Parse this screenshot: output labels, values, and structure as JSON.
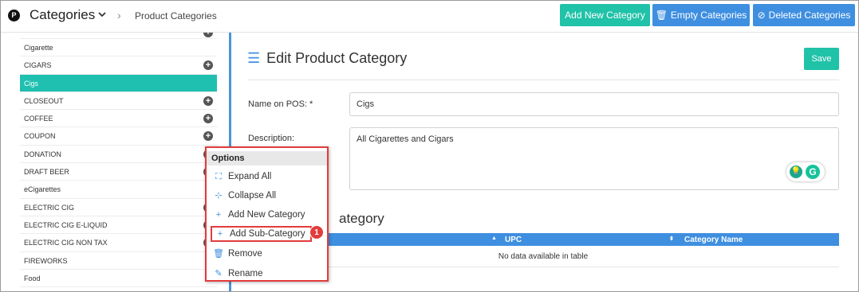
{
  "header": {
    "logo_letter": "P",
    "title": "Categories",
    "breadcrumb_sep": "›",
    "breadcrumb": "Product Categories",
    "add_new_label": "Add New Category",
    "empty_label": "Empty Categories",
    "deleted_label": "Deleted Categories"
  },
  "sidebar": {
    "items": [
      {
        "label": "",
        "plus": true,
        "partial": true
      },
      {
        "label": "Cigarette",
        "plus": false
      },
      {
        "label": "CIGARS",
        "plus": true
      },
      {
        "label": "Cigs",
        "plus": false,
        "selected": true
      },
      {
        "label": "CLOSEOUT",
        "plus": true
      },
      {
        "label": "COFFEE",
        "plus": true
      },
      {
        "label": "COUPON",
        "plus": true
      },
      {
        "label": "DONATION",
        "plus": true
      },
      {
        "label": "DRAFT BEER",
        "plus": true
      },
      {
        "label": "eCigarettes",
        "plus": false
      },
      {
        "label": "ELECTRIC CIG",
        "plus": true
      },
      {
        "label": "ELECTRIC CIG E-LIQUID",
        "plus": true
      },
      {
        "label": "ELECTRIC CIG NON TAX",
        "plus": true
      },
      {
        "label": "FIREWORKS",
        "plus": false
      },
      {
        "label": "Food",
        "plus": false
      }
    ]
  },
  "form": {
    "title": "Edit Product Category",
    "save_label": "Save",
    "name_label": "Name on POS: *",
    "name_value": "Cigs",
    "desc_label": "Description:",
    "desc_value": "All Cigarettes and Cigars"
  },
  "subcategory": {
    "title_fragment": "ategory",
    "columns": [
      "UPC",
      "Category Name"
    ],
    "empty_text": "No data available in table"
  },
  "context_menu": {
    "heading": "Options",
    "items": [
      {
        "label": "Expand All",
        "icon": "expand-icon"
      },
      {
        "label": "Collapse All",
        "icon": "collapse-icon"
      },
      {
        "label": "Add New Category",
        "icon": "plus-icon"
      },
      {
        "label": "Add Sub-Category",
        "icon": "plus-icon",
        "highlighted": true
      },
      {
        "label": "Remove",
        "icon": "trash-icon"
      },
      {
        "label": "Rename",
        "icon": "edit-icon"
      }
    ],
    "step_badge": "1"
  },
  "colors": {
    "teal": "#20c2a8",
    "blue": "#3f8fe0",
    "highlight_red": "#e23c3c",
    "selected_row": "#1fc0b0"
  }
}
